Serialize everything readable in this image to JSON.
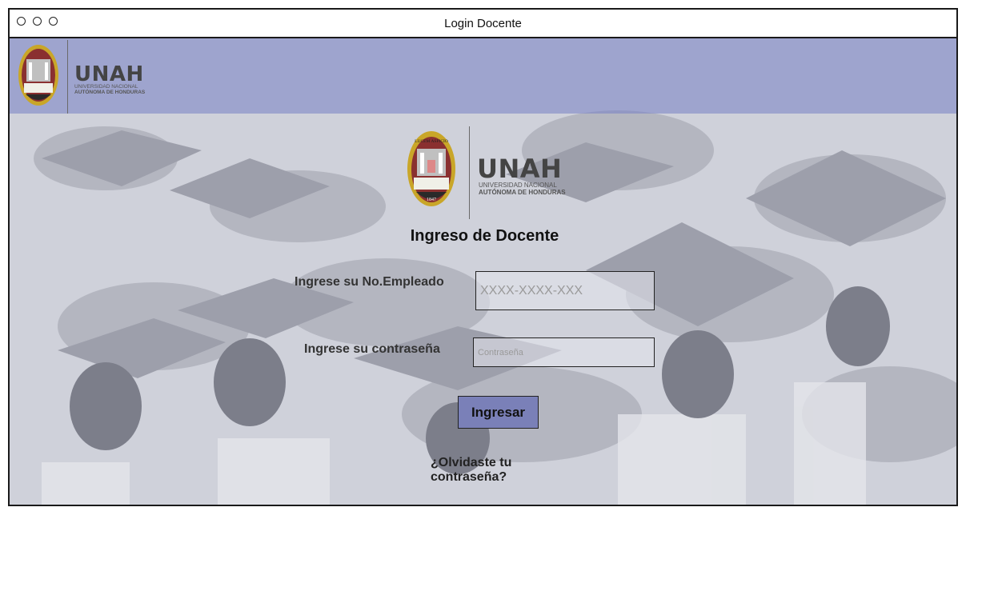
{
  "window": {
    "title": "Login Docente"
  },
  "header": {
    "brand_name": "UNAH",
    "brand_line1": "UNIVERSIDAD NACIONAL",
    "brand_line2": "AUTÓNOMA DE HONDURAS",
    "seal_motto": "LUCEM ASPICIO",
    "seal_year": "1847"
  },
  "form": {
    "title": "Ingreso de Docente",
    "employee_label": "Ingrese su No.Empleado",
    "employee_placeholder": "XXXX-XXXX-XXX",
    "password_label": "Ingrese su contraseña",
    "password_placeholder": "Contraseña",
    "submit_label": "Ingresar",
    "forgot_link": "¿Olvidaste tu contraseña?"
  },
  "colors": {
    "header_band": "#8088c4",
    "button": "#7a80b8",
    "background": "#d9dbe4"
  },
  "icons": [
    "window-dot-icon",
    "unah-seal-icon"
  ]
}
